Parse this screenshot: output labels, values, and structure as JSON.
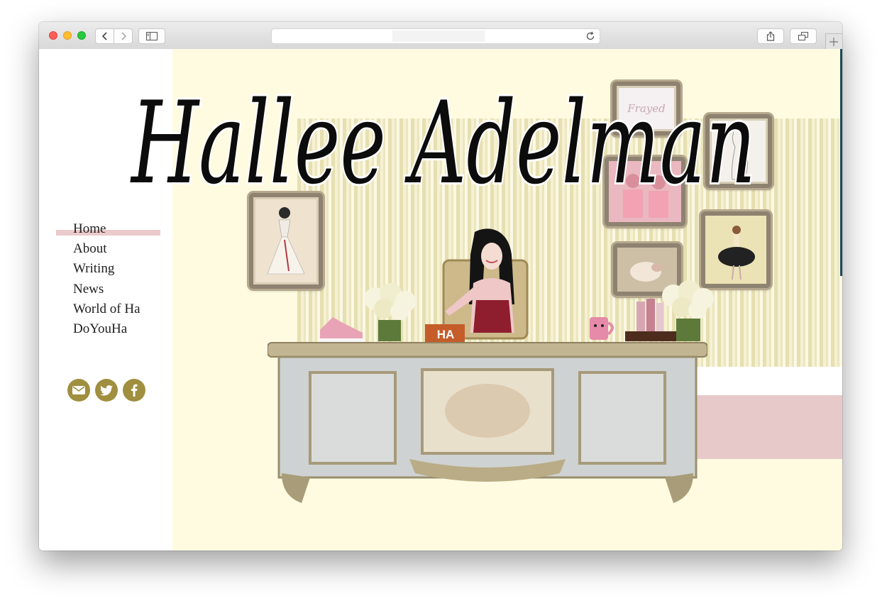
{
  "browser": {
    "address": "",
    "icons": {
      "back": "chevron-left-icon",
      "forward": "chevron-right-icon",
      "sidebar": "sidebar-icon",
      "reload": "reload-icon",
      "share": "share-icon",
      "tabs": "tabs-icon",
      "new_tab": "plus-icon"
    }
  },
  "site": {
    "title": "Hallee Adelman",
    "nav": [
      {
        "label": "Home",
        "active": true
      },
      {
        "label": "About"
      },
      {
        "label": "Writing"
      },
      {
        "label": "News"
      },
      {
        "label": "World of Ha"
      },
      {
        "label": "DoYouHa"
      }
    ],
    "social": [
      {
        "name": "email",
        "icon": "envelope-icon"
      },
      {
        "name": "twitter",
        "icon": "twitter-icon"
      },
      {
        "name": "facebook",
        "icon": "facebook-icon"
      }
    ],
    "desk_nameplate": "HA",
    "frame_text": "Frayed",
    "colors": {
      "background": "#fefbe1",
      "accent_pink": "#ebcacb",
      "social_gold": "#a08f3f",
      "wallpaper_stripe": "#e6dfb1",
      "text": "#1e1e1e"
    }
  }
}
